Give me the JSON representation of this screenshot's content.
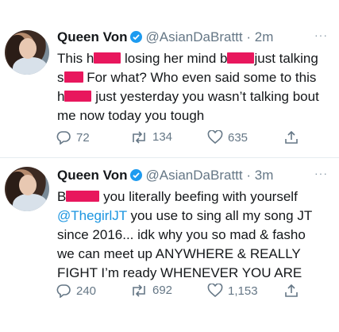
{
  "tweets": [
    {
      "name": "Queen Von",
      "handle": "@AsianDaBrattt",
      "time": "· 2m",
      "more": "···",
      "lines": [
        {
          "parts": [
            "This h",
            "",
            " losing her mind b",
            "",
            "just talking"
          ]
        },
        {
          "parts": [
            "s",
            "",
            " For what? Who even said some to this"
          ]
        },
        {
          "parts": [
            "h",
            "",
            " just yesterday you wasn’t talking bout"
          ]
        },
        {
          "parts": [
            "me now today you tough"
          ]
        }
      ],
      "replies": "72",
      "retweets": "134",
      "likes": "635"
    },
    {
      "name": "Queen Von",
      "handle": "@AsianDaBrattt",
      "time": "· 3m",
      "more": "···",
      "lines": [
        {
          "parts": [
            "B",
            "",
            " you literally beefing with yourself"
          ]
        },
        {
          "parts": [
            "@ThegirlJT",
            " you use to sing all my song JT"
          ]
        },
        {
          "parts": [
            "since 2016... idk why you so mad & fasho"
          ]
        },
        {
          "parts": [
            "we can meet up ANYWHERE & REALLY"
          ]
        },
        {
          "parts": [
            "FIGHT I’m ready WHENEVER YOU ARE"
          ]
        }
      ],
      "replies": "240",
      "retweets": "692",
      "likes": "1,153"
    }
  ],
  "colors": {
    "censor": "#e8175d",
    "verified": "#1d9bf0",
    "mention": "#1b95e0",
    "muted": "#657786"
  },
  "icons": {
    "reply": "reply-icon",
    "retweet": "retweet-icon",
    "like": "heart-icon",
    "share": "share-icon",
    "verified": "verified-badge-icon",
    "more": "more-options-icon"
  }
}
